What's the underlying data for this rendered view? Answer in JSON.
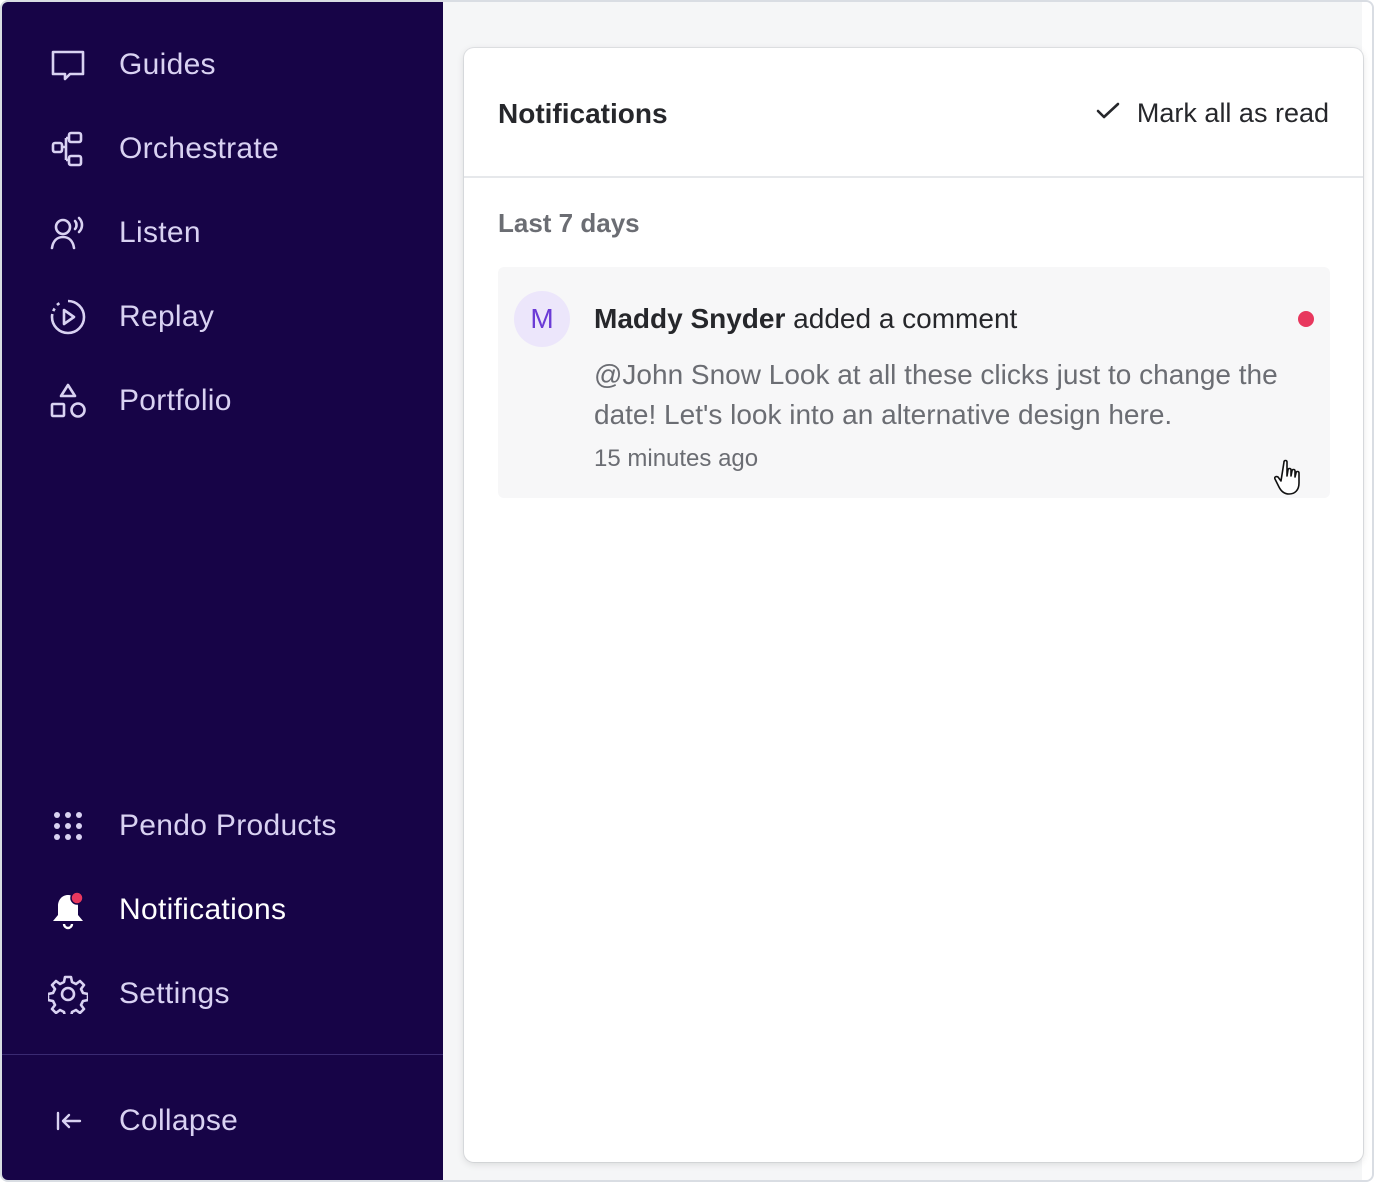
{
  "sidebar": {
    "items": [
      {
        "label": "Guides",
        "icon": "chat-bubble-icon"
      },
      {
        "label": "Orchestrate",
        "icon": "workflow-icon"
      },
      {
        "label": "Listen",
        "icon": "listen-user-icon"
      },
      {
        "label": "Replay",
        "icon": "replay-play-icon"
      },
      {
        "label": "Portfolio",
        "icon": "shapes-icon"
      }
    ],
    "bottom_items": [
      {
        "label": "Pendo Products",
        "icon": "grid-dots-icon"
      },
      {
        "label": "Notifications",
        "icon": "bell-icon"
      },
      {
        "label": "Settings",
        "icon": "gear-icon"
      }
    ],
    "collapse_label": "Collapse",
    "colors": {
      "background": "#170447",
      "text": "#d9d2f2",
      "badge": "#e8385e"
    }
  },
  "panel": {
    "title": "Notifications",
    "mark_all_label": "Mark all as read",
    "section_label": "Last 7 days",
    "notifications": [
      {
        "avatar_initial": "M",
        "author": "Maddy Snyder",
        "action": "added a comment",
        "body": "@John Snow Look at all these clicks just to change the date! Let's look into an alternative design here.",
        "time": "15 minutes ago",
        "unread": true
      }
    ]
  }
}
